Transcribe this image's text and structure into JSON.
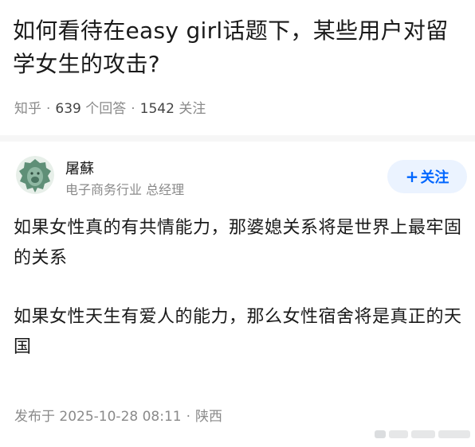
{
  "question": {
    "title": "如何看待在easy girl话题下，某些用户对留学女生的攻击?",
    "source": "知乎",
    "answer_count": "639",
    "answer_count_unit": "个回答",
    "follower_count": "1542",
    "follower_label": "关注",
    "separator": "·"
  },
  "author": {
    "avatar": "lion-avatar-icon",
    "name": "屠蘇",
    "headline": "电子商务行业 总经理",
    "follow_plus": "+",
    "follow_label": "关注"
  },
  "answer": {
    "paragraphs": [
      "如果女性真的有共情能力，那婆媳关系将是世界上最牢固的关系",
      "如果女性天生有爱人的能力，那么女性宿舍将是真正的天国"
    ]
  },
  "publish": {
    "prefix": "发布于",
    "datetime": "2025-10-28 08:11",
    "separator": "·",
    "location": "陕西"
  },
  "colors": {
    "accent": "#0066ff",
    "follow_bg": "#ebf3ff",
    "text": "#1a1a1a",
    "muted": "#8a8a8a"
  }
}
